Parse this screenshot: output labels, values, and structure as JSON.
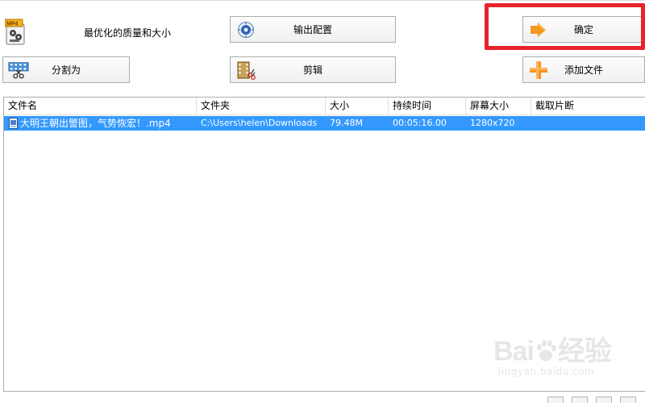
{
  "toolbar": {
    "profile_label": "最优化的质量和大小",
    "output_config_label": "输出配置",
    "confirm_label": "确定",
    "split_label": "分割为",
    "edit_label": "剪辑",
    "add_file_label": "添加文件",
    "profile_icon_badge": "MP4"
  },
  "icons": {
    "profile": "mp4-film-icon",
    "output_config": "settings-gear-icon",
    "confirm": "arrow-right-icon",
    "split": "film-scissors-icon",
    "edit": "film-clip-icon",
    "add_file": "plus-icon"
  },
  "table": {
    "columns": [
      "文件名",
      "文件夹",
      "大小",
      "持续时间",
      "屏幕大小",
      "截取片断"
    ],
    "rows": [
      {
        "name": "大明王朝出警图，气势恢宏！.mp4",
        "folder": "C:\\Users\\helen\\Downloads",
        "size": "79.48M",
        "duration": "00:05:16.00",
        "resolution": "1280x720",
        "clip": ""
      }
    ]
  },
  "watermark": {
    "brand": "Bai",
    "brand_tail": "经验",
    "url": "jingyan.baidu.com"
  },
  "colors": {
    "selection": "#3399ff",
    "highlight": "#e8232c",
    "arrow": "#f39a1e",
    "plus": "#f7941d"
  }
}
